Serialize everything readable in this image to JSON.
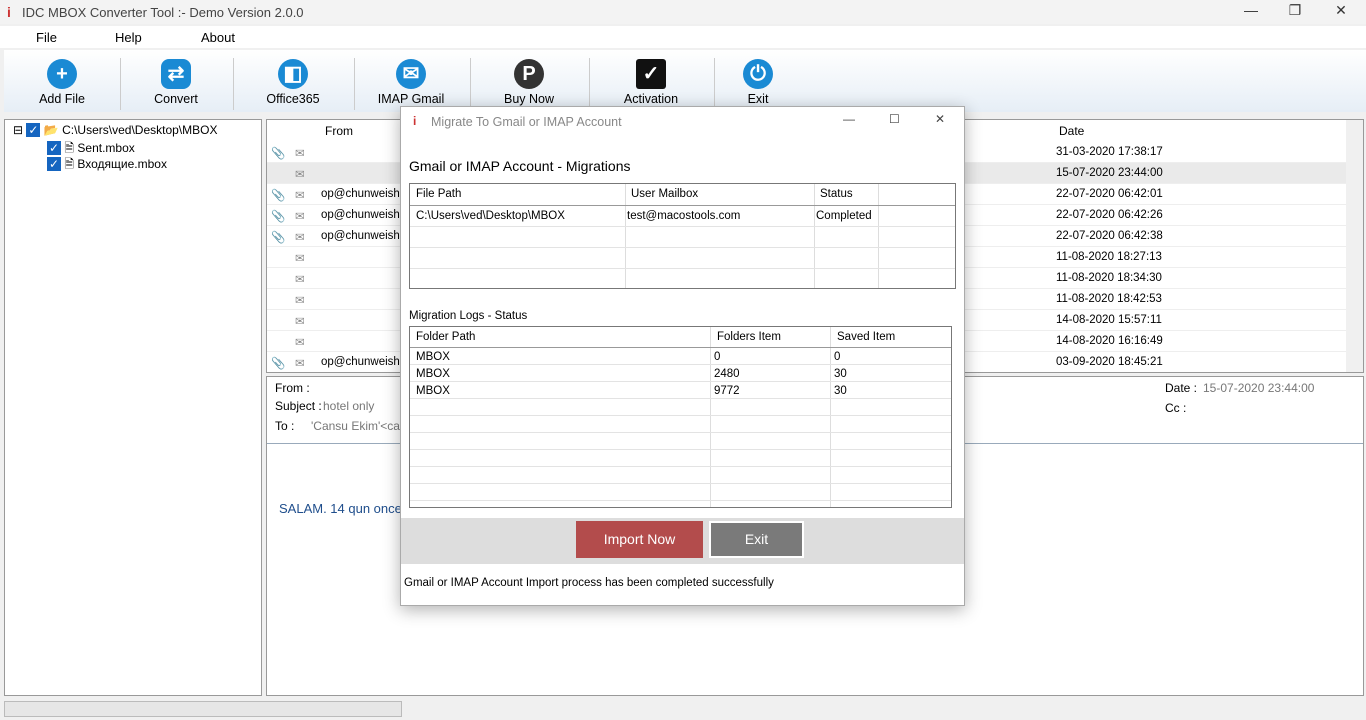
{
  "window": {
    "title": "IDC MBOX Converter Tool  :- Demo Version 2.0.0"
  },
  "menu": [
    "File",
    "Help",
    "About"
  ],
  "toolbar": [
    {
      "label": "Add File",
      "icon": "plus-icon"
    },
    {
      "label": "Convert",
      "icon": "convert-icon"
    },
    {
      "label": "Office365",
      "icon": "office-icon"
    },
    {
      "label": "IMAP Gmail",
      "icon": "mail-icon"
    },
    {
      "label": "Buy Now",
      "icon": "paypal-icon"
    },
    {
      "label": "Activation",
      "icon": "monitor-check-icon"
    },
    {
      "label": "Exit",
      "icon": "power-icon"
    }
  ],
  "tree": {
    "root": "C:\\Users\\ved\\Desktop\\MBOX",
    "children": [
      "Sent.mbox",
      "Входящие.mbox"
    ]
  },
  "emails": {
    "headers": {
      "from": "From",
      "date": "Date"
    },
    "rows": [
      {
        "attach": true,
        "from": "",
        "date": "31-03-2020 17:38:17"
      },
      {
        "attach": false,
        "from": "",
        "date": "15-07-2020 23:44:00"
      },
      {
        "attach": true,
        "from": "op@chunweiship",
        "date": "22-07-2020 06:42:01"
      },
      {
        "attach": true,
        "from": "op@chunweiship",
        "date": "22-07-2020 06:42:26"
      },
      {
        "attach": true,
        "from": "op@chunweiship",
        "date": "22-07-2020 06:42:38"
      },
      {
        "attach": false,
        "from": "",
        "date": "11-08-2020 18:27:13"
      },
      {
        "attach": false,
        "from": "",
        "date": "11-08-2020 18:34:30"
      },
      {
        "attach": false,
        "from": "",
        "date": "11-08-2020 18:42:53"
      },
      {
        "attach": false,
        "from": "",
        "date": "14-08-2020 15:57:11"
      },
      {
        "attach": false,
        "from": "",
        "date": "14-08-2020 16:16:49"
      },
      {
        "attach": true,
        "from": "op@chunweiship",
        "date": "03-09-2020 18:45:21"
      }
    ]
  },
  "preview": {
    "from_label": "From :",
    "subject_label": "Subject :",
    "subject": "hotel only",
    "to_label": "To :",
    "to": "'Cansu Ekim'<cansu",
    "date_label": "Date :",
    "date": "15-07-2020 23:44:00",
    "cc_label": "Cc :",
    "body": "SALAM. 14 qun once"
  },
  "dialog": {
    "title": "Migrate To Gmail or IMAP Account",
    "heading": "Gmail or IMAP Account - Migrations",
    "mig_headers": [
      "File Path",
      "User Mailbox",
      "Status"
    ],
    "mig_rows": [
      [
        "C:\\Users\\ved\\Desktop\\MBOX",
        "test@macostools.com",
        "Completed"
      ]
    ],
    "logs_label": "Migration Logs - Status",
    "log_headers": [
      "Folder Path",
      "Folders Item",
      "Saved Item"
    ],
    "log_rows": [
      [
        "MBOX",
        "0",
        "0"
      ],
      [
        "MBOX",
        "2480",
        "30"
      ],
      [
        "MBOX",
        "9772",
        "30"
      ]
    ],
    "import_label": "Import Now",
    "exit_label": "Exit",
    "status": "Gmail or IMAP Account Import process has been completed successfully"
  },
  "colors": {
    "accent": "#1a8ad4",
    "import": "#b34c4c",
    "exit": "#7a7a7a"
  }
}
